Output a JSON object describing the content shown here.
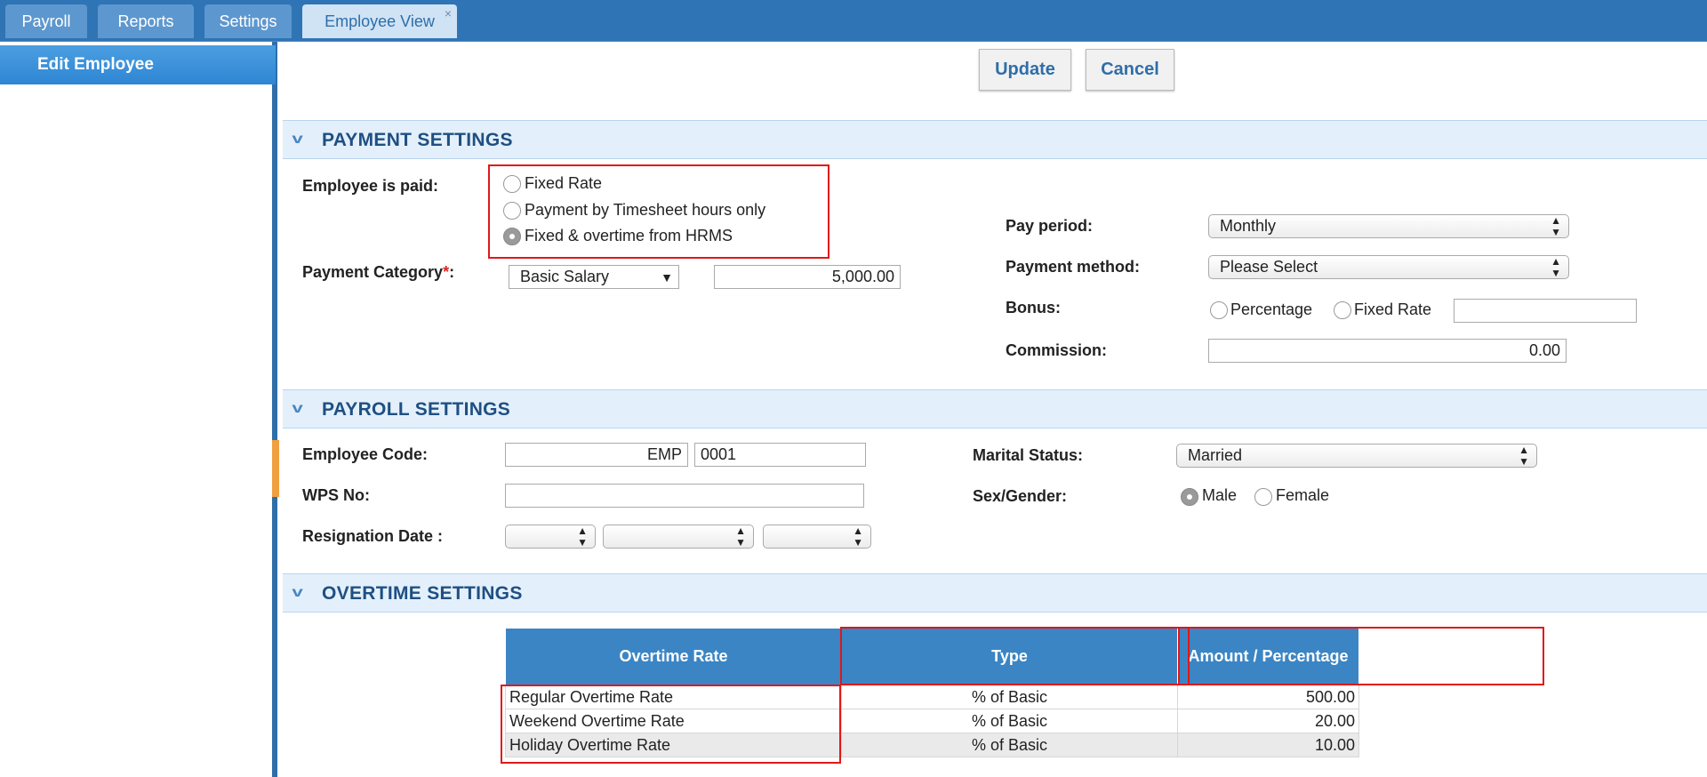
{
  "tabs": [
    {
      "label": "Payroll"
    },
    {
      "label": "Reports"
    },
    {
      "label": "Settings"
    },
    {
      "label": "Employee View",
      "close": "×"
    }
  ],
  "sidebar": {
    "items": [
      {
        "label": "Edit Employee"
      }
    ]
  },
  "actions": {
    "update": "Update",
    "cancel": "Cancel"
  },
  "payment_settings": {
    "title": "PAYMENT SETTINGS",
    "paid_label": "Employee is paid:",
    "paid_options": [
      "Fixed Rate",
      "Payment by Timesheet hours only",
      "Fixed & overtime from HRMS"
    ],
    "paid_selected": "Fixed & overtime from HRMS",
    "category_label": "Payment Category",
    "category_required": "*",
    "category_colon": ":",
    "category_value": "Basic Salary",
    "category_amount": "5,000.00",
    "pay_period_label": "Pay period:",
    "pay_period_value": "Monthly",
    "payment_method_label": "Payment method:",
    "payment_method_value": "Please Select",
    "bonus_label": "Bonus:",
    "bonus_options": [
      "Percentage",
      "Fixed Rate"
    ],
    "bonus_value": "",
    "commission_label": "Commission:",
    "commission_value": "0.00"
  },
  "payroll_settings": {
    "title": "PAYROLL SETTINGS",
    "employee_code_label": "Employee Code:",
    "employee_code_prefix": "EMP",
    "employee_code_number": "0001",
    "wps_label": "WPS No:",
    "wps_value": "",
    "resignation_label": "Resignation Date :",
    "marital_label": "Marital Status:",
    "marital_value": "Married",
    "gender_label": "Sex/Gender:",
    "gender_options": [
      "Male",
      "Female"
    ],
    "gender_selected": "Male"
  },
  "overtime_settings": {
    "title": "OVERTIME SETTINGS",
    "columns": [
      "Overtime Rate",
      "Type",
      "Amount / Percentage"
    ],
    "rows": [
      {
        "rate": "Regular Overtime Rate",
        "type": "% of Basic",
        "amount": "500.00"
      },
      {
        "rate": "Weekend Overtime Rate",
        "type": "% of Basic",
        "amount": "20.00"
      },
      {
        "rate": "Holiday Overtime Rate",
        "type": "% of Basic",
        "amount": "10.00"
      }
    ]
  },
  "colors": {
    "topbar": "#2f74b5",
    "section_bg": "#e3f0fb",
    "section_title": "#1f4f82",
    "table_header": "#3b85c4",
    "highlight": "#e01818",
    "button_text": "#2f6ea8"
  },
  "icons": [
    "chevron-down-icon",
    "close-icon",
    "select-arrows-icon",
    "dropdown-triangle-icon"
  ]
}
